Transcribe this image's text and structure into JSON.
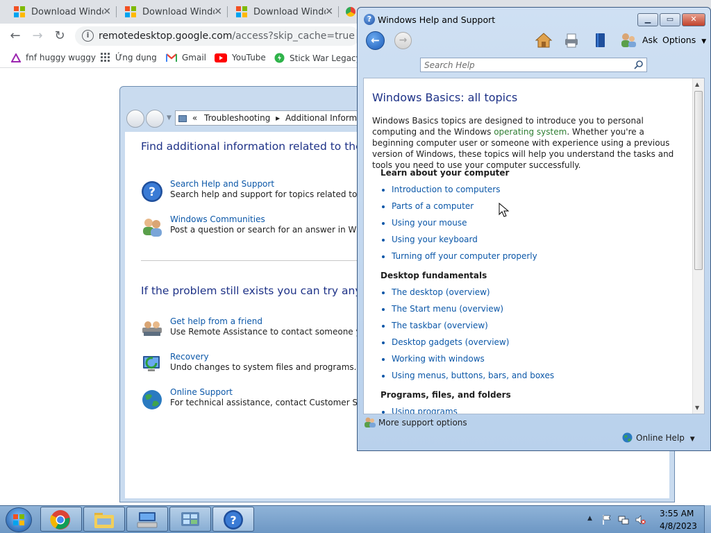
{
  "browser": {
    "tabs": [
      {
        "label": "Download Windo"
      },
      {
        "label": "Download Windo"
      },
      {
        "label": "Download Windo"
      }
    ],
    "url_host": "remotedesktop.google.com",
    "url_path": "/access?skip_cache=true",
    "bookmarks": [
      {
        "label": "fnf huggy wuggy",
        "icon": "triangle-icon"
      },
      {
        "label": "Ứng dụng",
        "icon": "apps-grid-icon"
      },
      {
        "label": "Gmail",
        "icon": "gmail-icon"
      },
      {
        "label": "YouTube",
        "icon": "youtube-icon"
      },
      {
        "label": "Stick War Legacy M",
        "icon": "game-icon"
      }
    ]
  },
  "control_panel": {
    "breadcrumb_prefix": "«",
    "breadcrumb_1": "Troubleshooting",
    "breadcrumb_sep": "▸",
    "breadcrumb_2": "Additional Informatio",
    "heading_1": "Find additional information related to the pro",
    "items_top": [
      {
        "link": "Search Help and Support",
        "desc": "Search help and support for topics related to this pr",
        "icon": "help-icon"
      },
      {
        "link": "Windows Communities",
        "desc": "Post a question or search for an answer in Windows",
        "icon": "communities-icon"
      }
    ],
    "heading_2": "If the problem still exists you can try any of th",
    "items_bottom": [
      {
        "link": "Get help from a friend",
        "desc": "Use Remote Assistance to contact someone you tru",
        "icon": "remote-assistance-icon"
      },
      {
        "link": "Recovery",
        "desc": "Undo changes to system files and programs.",
        "icon": "recovery-icon"
      },
      {
        "link": "Online Support",
        "desc": "For technical assistance, contact Customer Support",
        "icon": "globe-icon"
      }
    ]
  },
  "help": {
    "title": "Windows Help and Support",
    "toolbar": {
      "ask": "Ask",
      "options": "Options"
    },
    "search_placeholder": "Search Help",
    "heading": "Windows Basics: all topics",
    "intro_1": "Windows Basics topics are designed to introduce you to personal computing and the Windows ",
    "intro_link": "operating system",
    "intro_2": ". Whether you're a beginning computer user or someone with experience using a previous version of Windows, these topics will help you understand the tasks and tools you need to use your computer successfully.",
    "sections": [
      {
        "title": "Learn about your computer",
        "topics": [
          "Introduction to computers",
          "Parts of a computer",
          "Using your mouse",
          "Using your keyboard",
          "Turning off your computer properly"
        ]
      },
      {
        "title": "Desktop fundamentals",
        "topics": [
          "The desktop (overview)",
          "The Start menu (overview)",
          "The taskbar (overview)",
          "Desktop gadgets (overview)",
          "Working with windows",
          "Using menus, buttons, bars, and boxes"
        ]
      },
      {
        "title": "Programs, files, and folders",
        "topics": [
          "Using programs"
        ]
      }
    ],
    "footer_more": "More support options",
    "footer_online": "Online Help"
  },
  "taskbar": {
    "time": "3:55 AM",
    "date": "4/8/2023"
  }
}
